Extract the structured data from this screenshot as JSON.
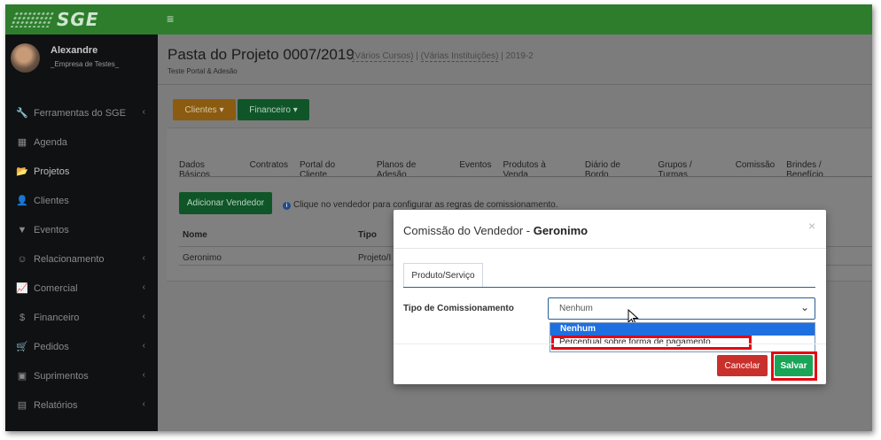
{
  "app": {
    "logo_text": "SGE"
  },
  "user": {
    "name": "Alexandre",
    "company": "_Empresa de Testes_"
  },
  "sidebar": {
    "items": [
      {
        "label": "Ferramentas do SGE",
        "icon": "wrench-icon",
        "glyph": "🔧",
        "has_children": true
      },
      {
        "label": "Agenda",
        "icon": "calendar-icon",
        "glyph": "▦",
        "has_children": false
      },
      {
        "label": "Projetos",
        "icon": "folder-open-icon",
        "glyph": "📂",
        "has_children": false,
        "active": true
      },
      {
        "label": "Clientes",
        "icon": "user-icon",
        "glyph": "👤",
        "has_children": false
      },
      {
        "label": "Eventos",
        "icon": "filter-icon",
        "glyph": "▼",
        "has_children": false
      },
      {
        "label": "Relacionamento",
        "icon": "smile-icon",
        "glyph": "☺",
        "has_children": true
      },
      {
        "label": "Comercial",
        "icon": "line-chart-icon",
        "glyph": "📈",
        "has_children": true
      },
      {
        "label": "Financeiro",
        "icon": "dollar-icon",
        "glyph": "$",
        "has_children": true
      },
      {
        "label": "Pedidos",
        "icon": "cart-icon",
        "glyph": "🛒",
        "has_children": true
      },
      {
        "label": "Suprimentos",
        "icon": "cubes-icon",
        "glyph": "▣",
        "has_children": true
      },
      {
        "label": "Relatórios",
        "icon": "report-icon",
        "glyph": "▤",
        "has_children": true
      }
    ],
    "chevron": "‹"
  },
  "page": {
    "title": "Pasta do Projeto 0007/2019",
    "sub_cursos": "(Vários Cursos)",
    "sub_sep1": " | ",
    "sub_instituicoes": "(Várias Instituições)",
    "sub_sep2": " | ",
    "sub_year": "2019-2",
    "description": "Teste Portal & Adesão"
  },
  "actions": {
    "clientes": "Clientes ▾",
    "financeiro": "Financeiro ▾"
  },
  "tabs": [
    "Dados Básicos",
    "Contratos",
    "Portal do Cliente",
    "Planos de Adesão",
    "Eventos",
    "Produtos à Venda",
    "Diário de Bordo",
    "Grupos / Turmas",
    "Comissão",
    "Brindes / Benefício"
  ],
  "commission": {
    "add_button": "Adicionar Vendedor",
    "hint": "Clique no vendedor para configurar as regras de comissionamento.",
    "columns": [
      "Nome",
      "Tipo"
    ],
    "rows": [
      {
        "name": "Geronimo",
        "type": "Projeto/I"
      }
    ]
  },
  "modal": {
    "title_prefix": "Comissão do Vendedor - ",
    "title_name": "Geronimo",
    "close": "×",
    "tab": "Produto/Serviço",
    "field_label": "Tipo de Comissionamento",
    "selected": "Nenhum",
    "options": [
      "Nenhum",
      "Percentual sobre forma de pagamento"
    ],
    "cancel": "Cancelar",
    "save": "Salvar"
  },
  "colors": {
    "brand": "#2d7d2d",
    "primary": "#1e6fe0",
    "danger": "#c9302c",
    "success": "#18a558",
    "highlight": "#e30613"
  }
}
